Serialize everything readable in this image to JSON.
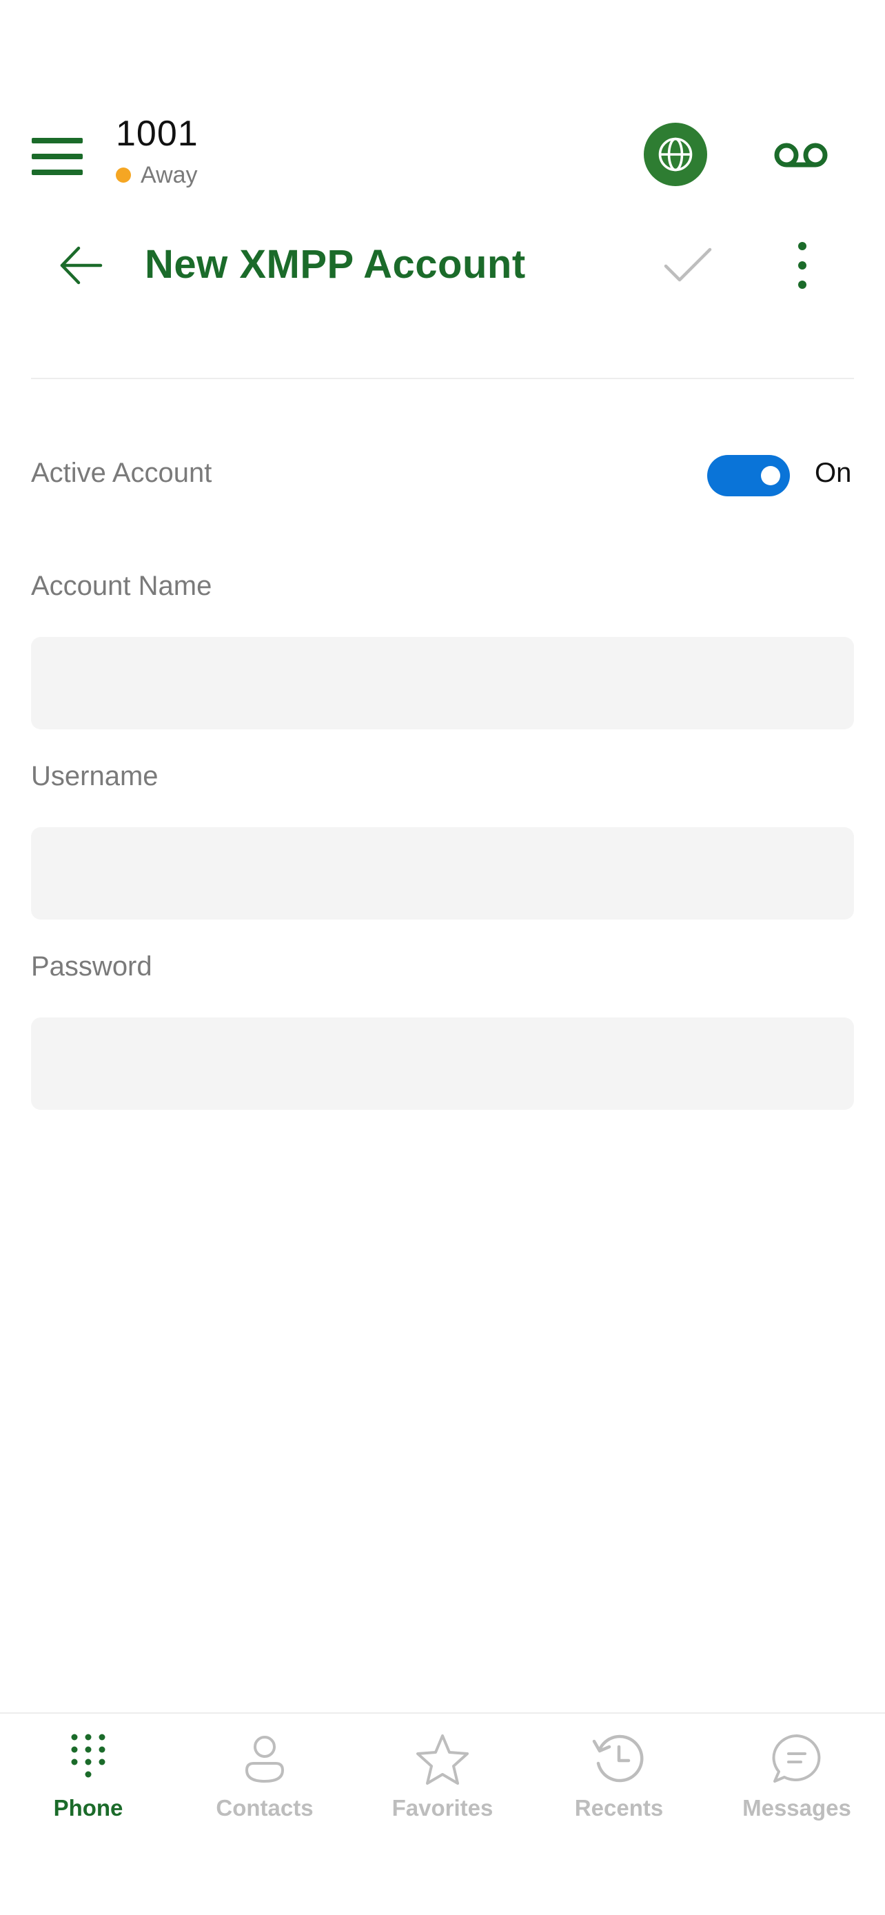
{
  "header": {
    "extension": "1001",
    "presence_status": "Away"
  },
  "titlebar": {
    "title": "New XMPP Account"
  },
  "form": {
    "active_account": {
      "label": "Active Account",
      "state_text": "On",
      "enabled": true
    },
    "account_name": {
      "label": "Account Name",
      "value": ""
    },
    "username": {
      "label": "Username",
      "value": ""
    },
    "password": {
      "label": "Password",
      "value": ""
    }
  },
  "tabs": [
    {
      "label": "Phone",
      "icon": "dialpad-icon",
      "active": true
    },
    {
      "label": "Contacts",
      "icon": "contact-icon",
      "active": false
    },
    {
      "label": "Favorites",
      "icon": "star-icon",
      "active": false
    },
    {
      "label": "Recents",
      "icon": "history-icon",
      "active": false
    },
    {
      "label": "Messages",
      "icon": "chat-icon",
      "active": false
    }
  ],
  "colors": {
    "brand_green": "#1b6b2a",
    "globe_bg": "#2e7d32",
    "toggle_blue": "#0a74d8",
    "away_orange": "#f5a623",
    "field_bg": "#f4f4f4",
    "inactive_gray": "#bdbdbd"
  }
}
